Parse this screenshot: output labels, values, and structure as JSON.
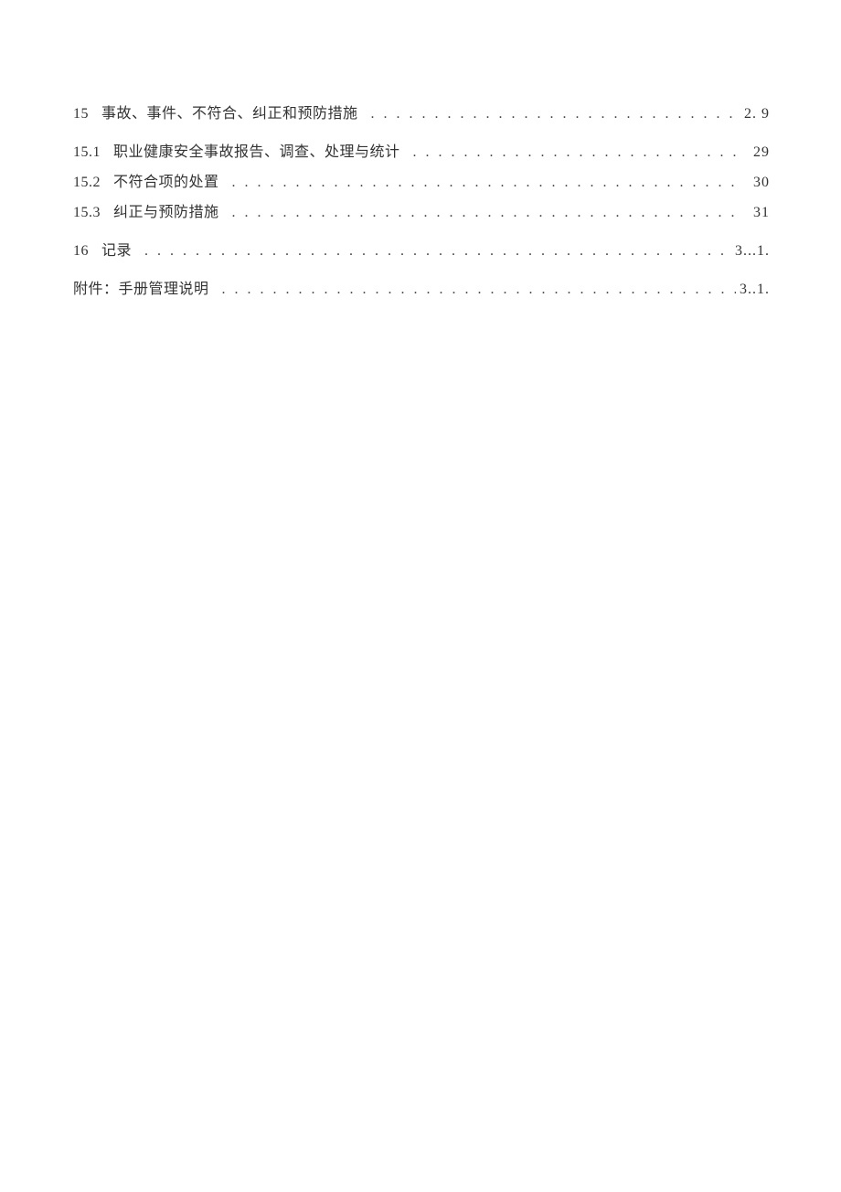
{
  "toc": {
    "entries": [
      {
        "num": "15",
        "title": "事故、事件、不符合、纠正和预防措施",
        "page": "2. 9",
        "level": 1,
        "spacedAfter": true
      },
      {
        "num": "15.1",
        "title": "职业健康安全事故报告、调查、处理与统计",
        "page": "29",
        "level": 2,
        "spacedAfter": false
      },
      {
        "num": "15.2",
        "title": "不符合项的处置",
        "page": "30",
        "level": 2,
        "spacedAfter": false
      },
      {
        "num": "15.3",
        "title": "纠正与预防措施",
        "page": "31",
        "level": 2,
        "spacedAfter": true
      },
      {
        "num": "16",
        "title": "记录",
        "page": "3...1.",
        "level": 1,
        "spacedAfter": true
      },
      {
        "num": "",
        "title": "附件：手册管理说明",
        "page": "3..1.",
        "level": 1,
        "spacedAfter": false
      }
    ],
    "dotsFill": ". . . . . . . . . . . . . . . . . . . . . . . . . . . . . . . . . . . . . . . . . . . . . . . . . . . . . . . . . . . . . . . . . . . . . . . . . . . . . . . . . . . . . . . . . . . . . . . . . . . . . . . . . . . . . . . . . . . . . . . ."
  }
}
